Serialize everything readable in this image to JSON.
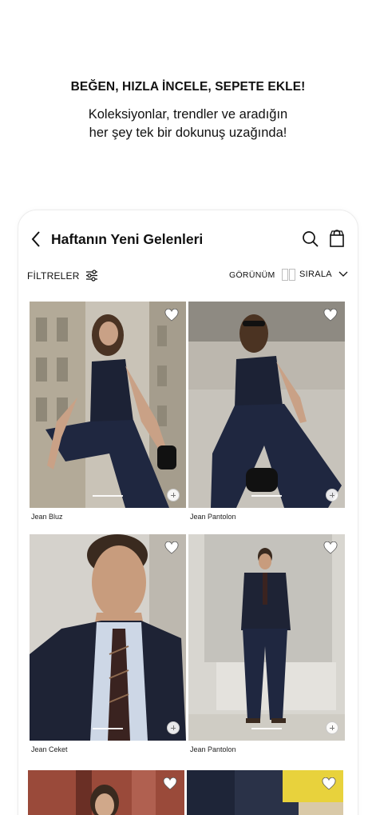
{
  "promo": {
    "title": "BEĞEN, HIZLA İNCELE, SEPETE EKLE!",
    "line1": "Koleksiyonlar, trendler ve aradığın",
    "line2": "her şey tek bir dokunuş uzağında!"
  },
  "header": {
    "title": "Haftanın Yeni Gelenleri",
    "back_icon": "chevron-left-icon",
    "search_icon": "search-icon",
    "bag_icon": "shopping-bag-icon"
  },
  "toolbar": {
    "filters_label": "FİLTRELER",
    "view_label": "GÖRÜNÜM",
    "sort_label": "SIRALA"
  },
  "products": [
    {
      "name": "Jean Bluz"
    },
    {
      "name": "Jean Pantolon"
    },
    {
      "name": "Jean Ceket"
    },
    {
      "name": "Jean Pantolon"
    },
    {
      "name": ""
    },
    {
      "name": ""
    }
  ],
  "colors": {
    "accent": "#111111",
    "denim": "#1d2438",
    "stone": "#b9b3a6"
  }
}
